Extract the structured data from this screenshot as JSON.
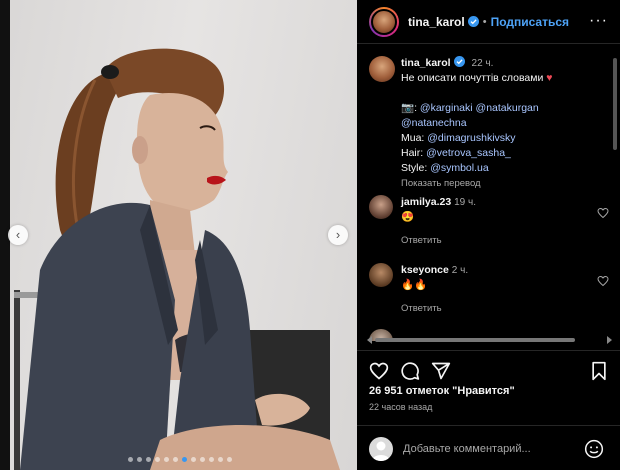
{
  "post": {
    "username": "tina_karol",
    "follow_label": "Подписаться",
    "dot_sep": "•",
    "more_label": "···"
  },
  "caption": {
    "username": "tina_karol",
    "time": "22 ч.",
    "line1": "Не описати почуттів словами",
    "heart": "♥",
    "camera": "📷:",
    "photo_credit_1": "@karginaki",
    "photo_credit_2": "@natakurgan",
    "photo_credit_3": "@natanechna",
    "mua_label": "Mua:",
    "mua_value": "@dimagrushkivsky",
    "hair_label": "Hair:",
    "hair_value": "@vetrova_sasha_",
    "style_label": "Style:",
    "style_value": "@symbol.ua",
    "translate_label": "Показать перевод"
  },
  "comments": [
    {
      "username": "jamilya.23",
      "time": "19 ч.",
      "text": "😍",
      "reply": "Ответить"
    },
    {
      "username": "kseyonce",
      "time": "2 ч.",
      "text": "🔥🔥",
      "reply": "Ответить"
    }
  ],
  "stats": {
    "likes": "26 951 отметок \"Нравится\"",
    "time_ago": "22 часов назад"
  },
  "add_comment": {
    "placeholder": "Добавьте комментарий..."
  },
  "colors": {
    "accent": "#4ea3f7",
    "active_dot": "#3897f0",
    "heart": "#ed4956"
  },
  "carousel": {
    "total_slides": 12,
    "active_slide": 6
  }
}
